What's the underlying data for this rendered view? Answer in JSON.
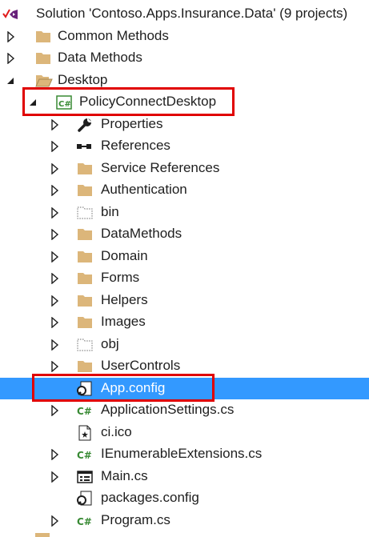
{
  "solution": {
    "label": "Solution 'Contoso.Apps.Insurance.Data' (9 projects)",
    "icon": "vs-solution-icon"
  },
  "folders": {
    "common_methods": "Common Methods",
    "data_methods": "Data Methods",
    "desktop": "Desktop"
  },
  "project": {
    "label": "PolicyConnectDesktop",
    "icon": "csharp-project-icon",
    "items": {
      "properties": "Properties",
      "references": "References",
      "service_references": "Service References",
      "authentication": "Authentication",
      "bin": "bin",
      "datamethods": "DataMethods",
      "domain": "Domain",
      "forms": "Forms",
      "helpers": "Helpers",
      "images": "Images",
      "obj": "obj",
      "usercontrols": "UserControls",
      "app_config": "App.config",
      "application_settings": "ApplicationSettings.cs",
      "ci_ico": "ci.ico",
      "ienumerable_extensions": "IEnumerableExtensions.cs",
      "main": "Main.cs",
      "packages_config": "packages.config",
      "program": "Program.cs"
    }
  },
  "selected_item": "App.config",
  "colors": {
    "selection": "#3399ff",
    "highlight_box": "#e00000",
    "folder": "#dcb67a",
    "csharp": "#388a34"
  }
}
